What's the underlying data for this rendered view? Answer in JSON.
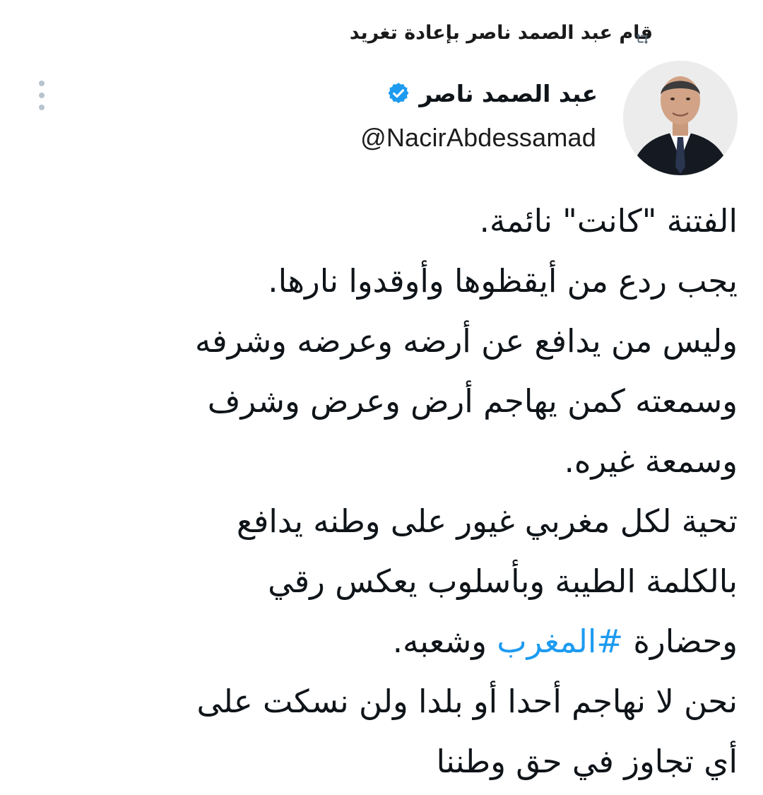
{
  "retweet": {
    "label": "قام عبد الصمد ناصر بإعادة تغريد",
    "icon": "retweet-icon"
  },
  "more": {
    "icon": "more-vertical-icon"
  },
  "author": {
    "display_name": "عبد الصمد ناصر",
    "handle": "@NacirAbdessamad",
    "verified": true,
    "verified_icon": "verified-badge-icon",
    "verified_color": "#1d9bf0",
    "avatar_icon": "avatar"
  },
  "tweet": {
    "lines": [
      {
        "text": "الفتنة \"كانت\" نائمة."
      },
      {
        "text": "يجب ردع من أيقظوها وأوقدوا نارها."
      },
      {
        "text": "وليس من يدافع عن أرضه وعرضه وشرفه"
      },
      {
        "text": "وسمعته كمن يهاجم أرض وعرض وشرف"
      },
      {
        "text": "وسمعة غيره."
      },
      {
        "text": "تحية لكل مغربي غيور على وطنه يدافع"
      },
      {
        "text": "بالكلمة الطيبة وبأسلوب يعكس رقي"
      },
      {
        "before": "وحضارة ",
        "hashtag": "#المغرب",
        "after": " وشعبه."
      },
      {
        "text": "نحن لا نهاجم أحدا أو بلدا ولن نسكت على"
      },
      {
        "text": "أي تجاوز في حق وطننا"
      }
    ],
    "hashtag_color": "#1d9bf0"
  }
}
